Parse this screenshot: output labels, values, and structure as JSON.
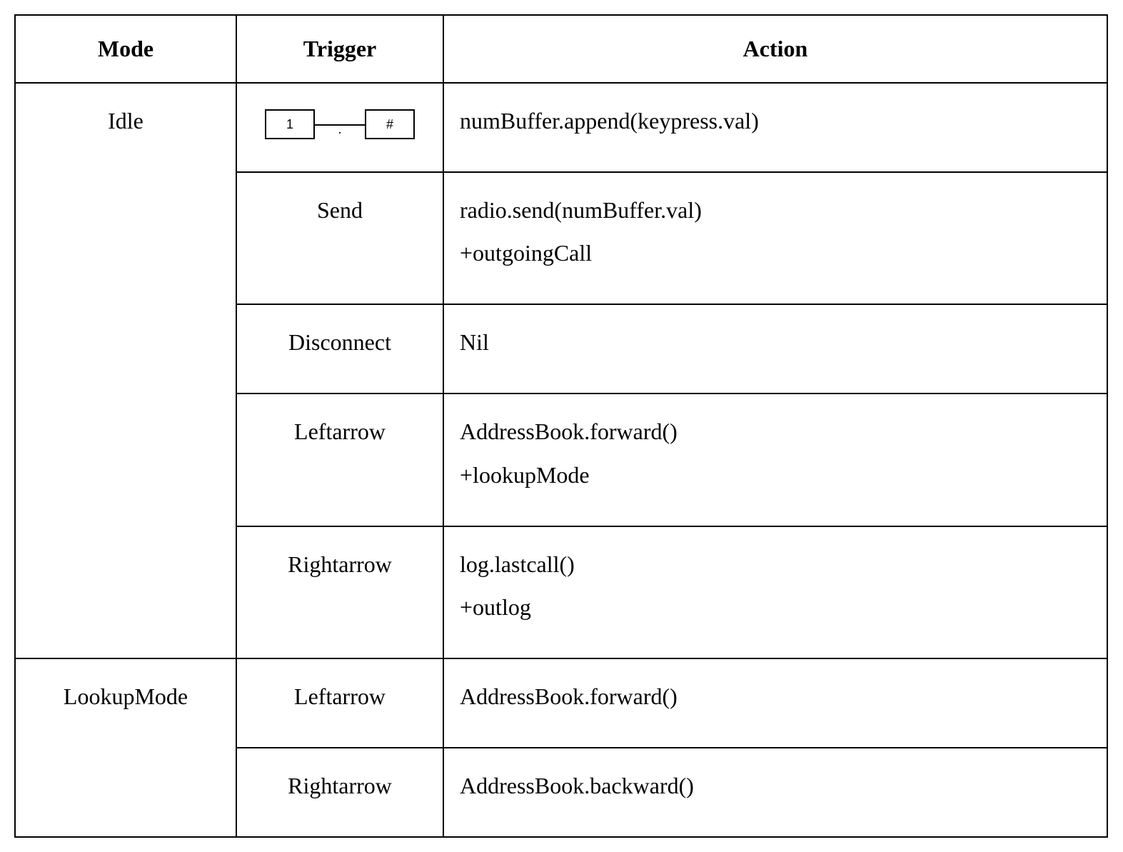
{
  "headers": {
    "mode": "Mode",
    "trigger": "Trigger",
    "action": "Action"
  },
  "rows": [
    {
      "mode": "Idle",
      "trigger_type": "keypad_range",
      "trigger_from": "1",
      "trigger_mid": ".",
      "trigger_to": "#",
      "action": "numBuffer.append(keypress.val)"
    },
    {
      "mode": "",
      "trigger": "Send",
      "action": "radio.send(numBuffer.val)\n+outgoingCall"
    },
    {
      "mode": "",
      "trigger": "Disconnect",
      "action": "Nil"
    },
    {
      "mode": "",
      "trigger": "Leftarrow",
      "action": "AddressBook.forward()\n+lookupMode"
    },
    {
      "mode": "",
      "trigger": "Rightarrow",
      "action": "log.lastcall()\n+outlog"
    },
    {
      "mode": "LookupMode",
      "trigger": "Leftarrow",
      "action": "AddressBook.forward()"
    },
    {
      "mode": "",
      "trigger": "Rightarrow",
      "action": "AddressBook.backward()"
    }
  ]
}
